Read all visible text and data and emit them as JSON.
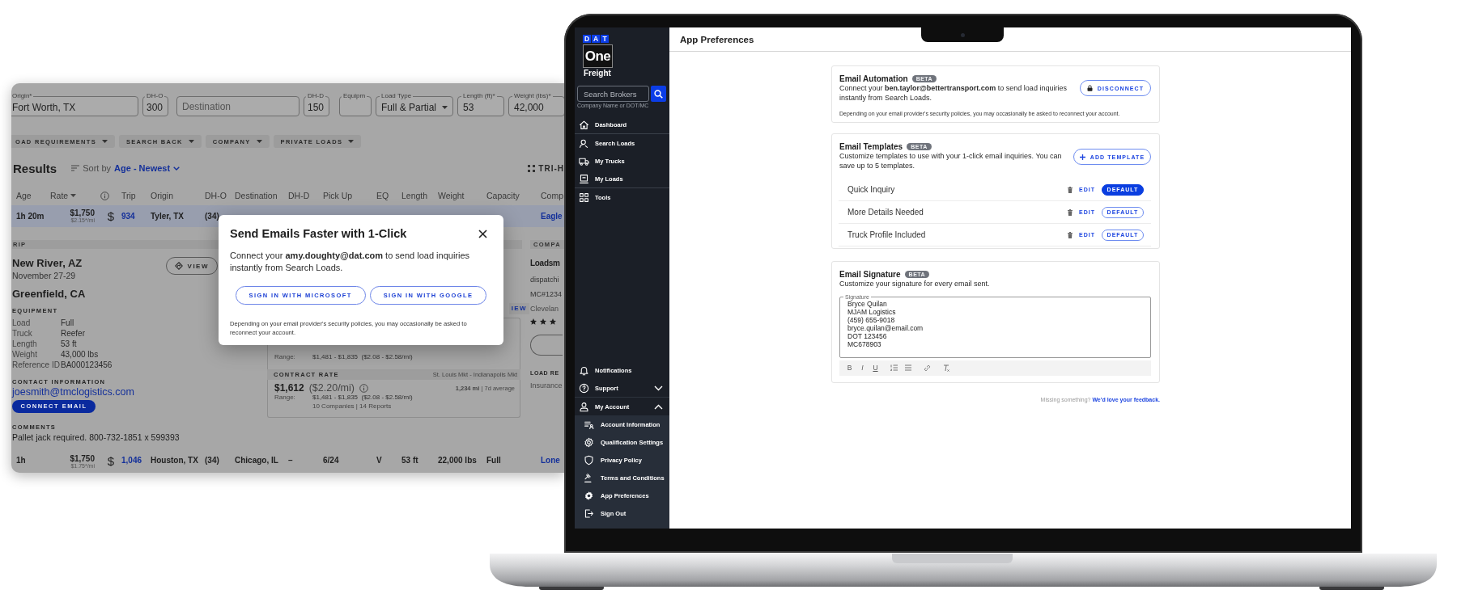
{
  "search_loads_window": {
    "filters": [
      {
        "kind": "text",
        "label": "Origin*",
        "value": "Fort Worth, TX"
      },
      {
        "kind": "text",
        "label": "DH-O",
        "value": "300"
      },
      {
        "kind": "text",
        "placeholder": "Destination"
      },
      {
        "kind": "text",
        "label": "DH-D",
        "value": "150"
      },
      {
        "kind": "text",
        "label": "Equipm"
      },
      {
        "kind": "select",
        "label": "Load Type",
        "value": "Full & Partial"
      },
      {
        "kind": "text",
        "label": "Length (ft)*",
        "value": "53"
      },
      {
        "kind": "text",
        "label": "Weight (lbs)*",
        "value": "42,000"
      }
    ],
    "filter_chips": [
      "OAD REQUIREMENTS",
      "SEARCH BACK",
      "COMPANY",
      "PRIVATE LOADS"
    ],
    "results": {
      "title": "Results",
      "sort_label": "Sort by",
      "sort_value": "Age - Newest",
      "view_toggle": "TRI-H"
    },
    "table": {
      "columns": [
        {
          "kind": "text",
          "label": "Age"
        },
        {
          "kind": "sort",
          "label": "Rate"
        },
        {
          "kind": "info"
        },
        {
          "kind": "text",
          "label": "Trip"
        },
        {
          "kind": "text",
          "label": "Origin"
        },
        {
          "kind": "text",
          "label": "DH-O"
        },
        {
          "kind": "text",
          "label": "Destination"
        },
        {
          "kind": "text",
          "label": "DH-D"
        },
        {
          "kind": "text",
          "label": "Pick Up"
        },
        {
          "kind": "text",
          "label": "EQ"
        },
        {
          "kind": "text",
          "label": "Length"
        },
        {
          "kind": "text",
          "label": "Weight"
        },
        {
          "kind": "text",
          "label": "Capacity"
        },
        {
          "kind": "text",
          "label": "Comp"
        }
      ],
      "rows": [
        {
          "selected": true,
          "cells": {
            "age": "1h 20m",
            "rate": "$1,750",
            "rate_per_mile": "$2.15*/mi",
            "pay": "$",
            "trip": "934",
            "origin": "Tyler, TX",
            "dh_o": "(34)",
            "company": "Eagle"
          }
        },
        {
          "selected": false,
          "cells": {
            "age": "1h",
            "rate": "$1,750",
            "rate_per_mile": "$1.75*/mi",
            "pay": "$",
            "trip": "1,046",
            "origin": "Houston, TX",
            "dh_o": "(34)",
            "destination": "Chicago, IL",
            "dh_d": "–",
            "pick_up": "6/24",
            "eq": "V",
            "length": "53 ft",
            "weight": "22,000 lbs",
            "capacity": "Full",
            "company": "Lone"
          }
        }
      ]
    },
    "trip_details": {
      "heading": "RIP",
      "stops": [
        {
          "place": "New River, AZ",
          "dates": "November 27-29"
        },
        {
          "place": "Greenfield, CA"
        }
      ],
      "view_button": "VIEW",
      "equipment_heading": "EQUIPMENT",
      "equipment": [
        {
          "label": "Load",
          "value": "Full"
        },
        {
          "label": "Truck",
          "value": "Reefer"
        },
        {
          "label": "Length",
          "value": "53 ft"
        },
        {
          "label": "Weight",
          "value": "43,000 lbs"
        },
        {
          "label": "Reference ID",
          "value": "BA000123456"
        }
      ],
      "contact_heading": "CONTACT INFORMATION",
      "contact_email": "joesmith@tmclogistics.com",
      "connect_button": "CONNECT EMAIL",
      "comments_heading": "COMMENTS",
      "comments": "Pallet jack required. 800-732-1851 x 599393"
    },
    "rates": {
      "view_link": "IEW",
      "spot_range_label": "Range:",
      "spot_range": "$1,481 - $1,835  ($2.08 - $2.58/mi)",
      "contract": {
        "heading": "CONTRACT RATE",
        "market": "St. Louis Mkt - Indianapolis Mkt",
        "rate": "$1,612",
        "per_mile": "($2.20/mi)",
        "miles": "**1,234 mi** | 7d average",
        "range_label": "Range:",
        "range": "$1,481 - $1,835  ($2.08 - $2.58/mi)",
        "reports": "10 Companies | 14 Reports"
      }
    },
    "company": {
      "heading": "COMPA",
      "name": "Loadsm",
      "email": "dispatchi",
      "mc": "MC#1234",
      "city": "Clevelan",
      "stars": 3,
      "load_heading": "LOAD RE",
      "insurance": "Insurance"
    },
    "modal": {
      "title": "Send Emails Faster with 1-Click",
      "text": "Connect your **amy.doughty@dat.com** to send load inquiries instantly from Search Loads.",
      "buttons": [
        "SIGN IN WITH MICROSOFT",
        "SIGN IN WITH GOOGLE"
      ],
      "note": "Depending on your email provider's security policies, you may occasionally be asked to reconnect your account."
    }
  },
  "laptop_app": {
    "logo": {
      "letters": [
        "D",
        "A",
        "T"
      ],
      "word": "One",
      "product": "Freight"
    },
    "broker_search": {
      "placeholder": "Search Brokers",
      "hint": "Company Name or DOT/MC"
    },
    "nav_groups": [
      [
        "Dashboard"
      ],
      [
        "Search Loads",
        "My Trucks",
        "My Loads"
      ],
      [
        "Tools"
      ]
    ],
    "bottom_nav": [
      {
        "label": "Notifications"
      },
      {
        "label": "Support",
        "expanded": false
      },
      {
        "label": "My Account",
        "expanded": true,
        "children": [
          "Account Information",
          "Qualification Settings",
          "Privacy Policy",
          "Terms and Conditions",
          "App Preferences",
          "Sign Out"
        ]
      }
    ],
    "page_title": "App Preferences",
    "email_automation": {
      "title": "Email Automation",
      "badge": "BETA",
      "text": "Connect your **ben.taylor@bettertransport.com** to send load inquiries instantly from Search Loads.",
      "note": "Depending on your email provider's security policies, you may occasionally be asked to reconnect your account.",
      "button": "DISCONNECT"
    },
    "email_templates": {
      "title": "Email Templates",
      "badge": "BETA",
      "text": "Customize templates to use with your 1-click email inquiries. You can save up to 5 templates.",
      "button": "ADD TEMPLATE",
      "templates": [
        {
          "name": "Quick Inquiry",
          "edit": "EDIT",
          "default": "DEFAULT",
          "selected": true
        },
        {
          "name": "More Details Needed",
          "edit": "EDIT",
          "default": "DEFAULT",
          "selected": false
        },
        {
          "name": "Truck Profile Included",
          "edit": "EDIT",
          "default": "DEFAULT",
          "selected": false
        }
      ]
    },
    "email_signature": {
      "title": "Email Signature",
      "badge": "BETA",
      "text": "Customize your signature for every email sent.",
      "field_label": "Signature",
      "lines": [
        "Bryce Quilan",
        "MJAM Logistics",
        "(459) 655-9018",
        "bryce.quilan@email.com",
        "DOT 123456",
        "MC678903"
      ],
      "format_buttons": [
        "B",
        "I",
        "U"
      ]
    },
    "feedback": {
      "prompt": "Missing something?",
      "link": "We'd love your feedback."
    }
  }
}
